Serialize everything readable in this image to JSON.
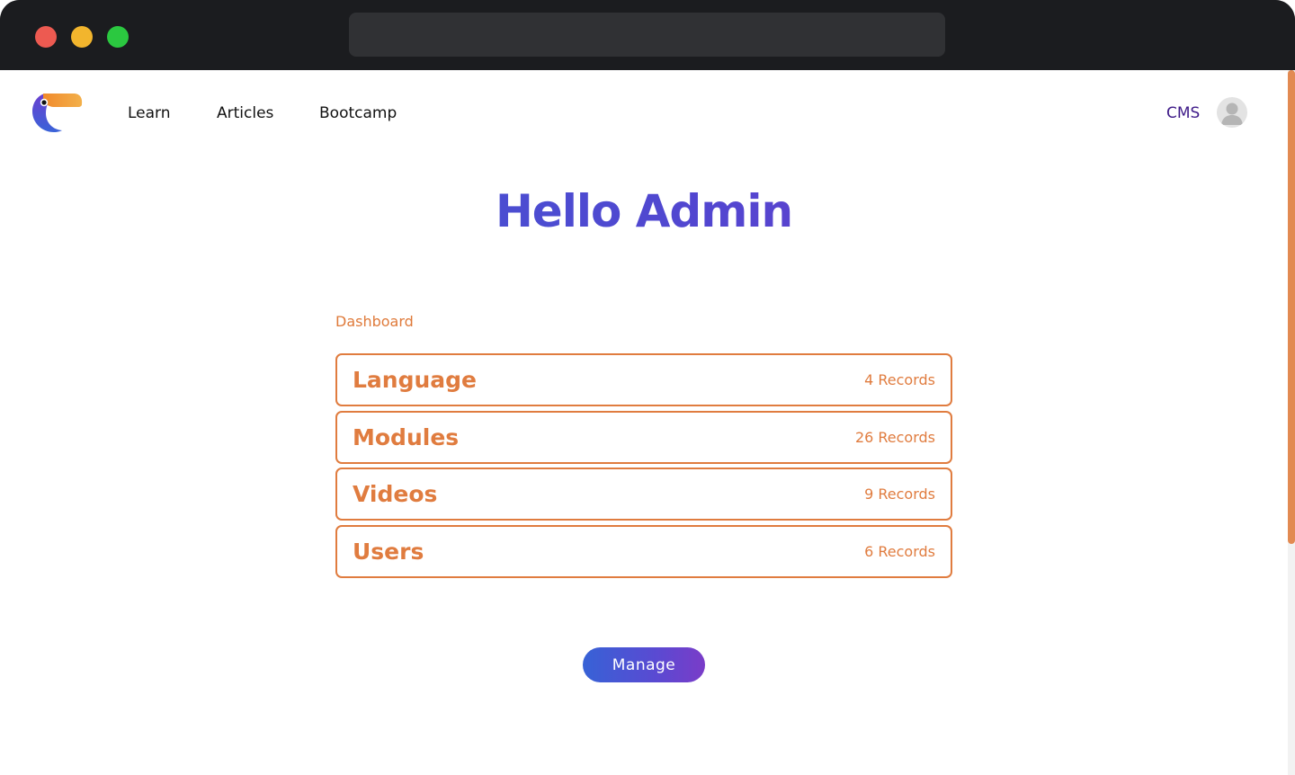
{
  "window": {
    "address_bar_value": ""
  },
  "nav": {
    "links": [
      {
        "label": "Learn"
      },
      {
        "label": "Articles"
      },
      {
        "label": "Bootcamp"
      }
    ],
    "cms_label": "CMS",
    "avatar_icon": "user-avatar-icon"
  },
  "hero": {
    "title": "Hello Admin"
  },
  "dashboard": {
    "label": "Dashboard",
    "records": [
      {
        "name": "Language",
        "count": "4 Records"
      },
      {
        "name": "Modules",
        "count": "26 Records"
      },
      {
        "name": "Videos",
        "count": "9 Records"
      },
      {
        "name": "Users",
        "count": "6 Records"
      }
    ]
  },
  "actions": {
    "manage_label": "Manage"
  },
  "colors": {
    "accent_orange": "#e07c3f",
    "gradient_start": "#3a5fd4",
    "gradient_end": "#7c3ac9",
    "cms_purple": "#3e1a88"
  }
}
